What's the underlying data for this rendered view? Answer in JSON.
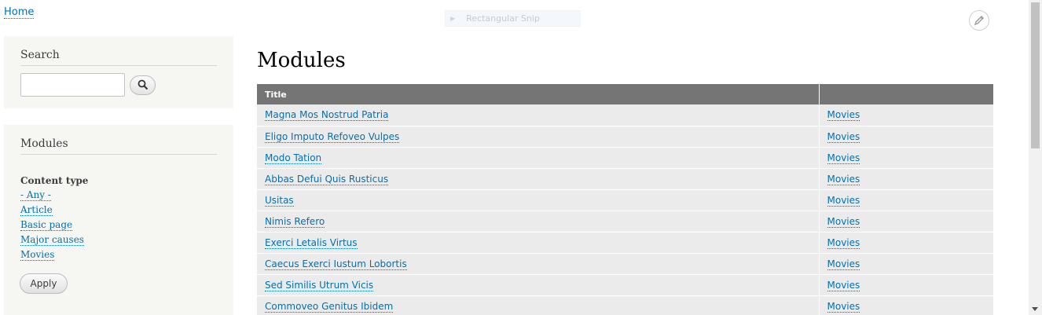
{
  "breadcrumb": {
    "home_label": "Home"
  },
  "snip_overlay": {
    "label": "Rectangular Snip"
  },
  "sidebar": {
    "search_block": {
      "title": "Search",
      "input_value": "",
      "button_icon": "search-icon"
    },
    "modules_block": {
      "title": "Modules",
      "filter_heading": "Content type",
      "filters": [
        "- Any -",
        "Article",
        "Basic page",
        "Major causes",
        "Movies"
      ],
      "apply_label": "Apply"
    }
  },
  "main": {
    "page_title": "Modules",
    "table": {
      "columns": [
        "Title",
        ""
      ],
      "rows": [
        [
          "Magna Mos Nostrud Patria",
          "Movies"
        ],
        [
          "Eligo Imputo Refoveo Vulpes",
          "Movies"
        ],
        [
          "Modo Tation",
          "Movies"
        ],
        [
          "Abbas Defui Quis Rusticus",
          "Movies"
        ],
        [
          "Usitas",
          "Movies"
        ],
        [
          "Nimis Refero",
          "Movies"
        ],
        [
          "Exerci Letalis Virtus",
          "Movies"
        ],
        [
          "Caecus Exerci Iustum Lobortis",
          "Movies"
        ],
        [
          "Sed Similis Utrum Vicis",
          "Movies"
        ],
        [
          "Commoveo Genitus Ibidem",
          "Movies"
        ]
      ]
    }
  },
  "colors": {
    "link": "#0071b3",
    "table_header": "#757575",
    "sidebar_bg": "#f6f6f2",
    "row_bg": "#ebebeb"
  }
}
